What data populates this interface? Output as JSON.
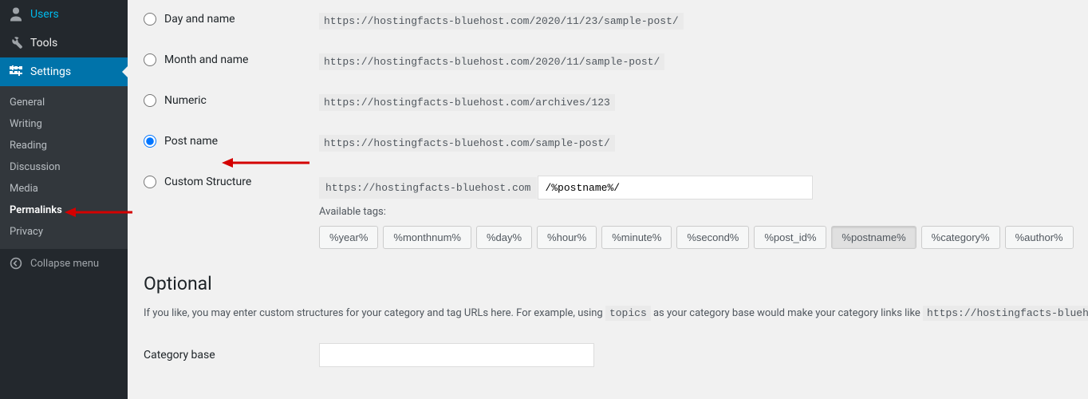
{
  "sidebar": {
    "users": "Users",
    "tools": "Tools",
    "settings": "Settings",
    "submenu": {
      "general": "General",
      "writing": "Writing",
      "reading": "Reading",
      "discussion": "Discussion",
      "media": "Media",
      "permalinks": "Permalinks",
      "privacy": "Privacy"
    },
    "collapse": "Collapse menu"
  },
  "permalinks": {
    "options": {
      "day_name": {
        "label": "Day and name",
        "sample": "https://hostingfacts-bluehost.com/2020/11/23/sample-post/"
      },
      "month_name": {
        "label": "Month and name",
        "sample": "https://hostingfacts-bluehost.com/2020/11/sample-post/"
      },
      "numeric": {
        "label": "Numeric",
        "sample": "https://hostingfacts-bluehost.com/archives/123"
      },
      "post_name": {
        "label": "Post name",
        "sample": "https://hostingfacts-bluehost.com/sample-post/"
      },
      "custom": {
        "label": "Custom Structure",
        "base": "https://hostingfacts-bluehost.com",
        "value": "/%postname%/"
      }
    },
    "available_tags_label": "Available tags:",
    "tags": {
      "year": "%year%",
      "monthnum": "%monthnum%",
      "day": "%day%",
      "hour": "%hour%",
      "minute": "%minute%",
      "second": "%second%",
      "post_id": "%post_id%",
      "postname": "%postname%",
      "category": "%category%",
      "author": "%author%"
    }
  },
  "optional": {
    "heading": "Optional",
    "desc_pre": "If you like, you may enter custom structures for your category and tag URLs here. For example, using ",
    "desc_code": "topics",
    "desc_mid": " as your category base would make your category links like ",
    "desc_sample": "https://hostingfacts-bluehost",
    "category_base_label": "Category base"
  }
}
